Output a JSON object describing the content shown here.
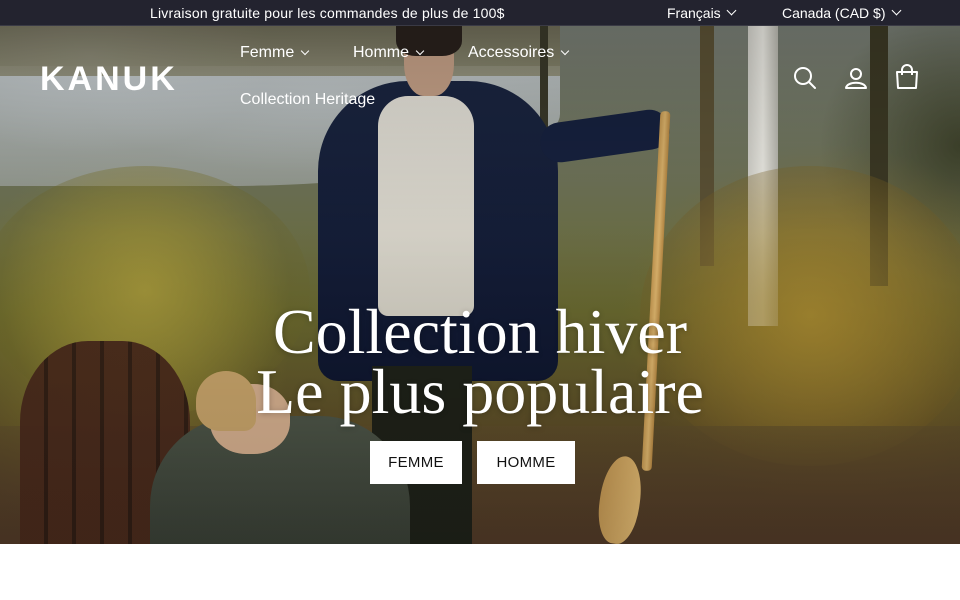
{
  "announcement": {
    "promo_text": "Livraison gratuite pour les commandes de plus de 100$",
    "language": "Français",
    "country": "Canada (CAD $)"
  },
  "header": {
    "logo": "KANUK",
    "nav": [
      {
        "label": "Femme",
        "has_dropdown": true
      },
      {
        "label": "Homme",
        "has_dropdown": true
      },
      {
        "label": "Accessoires",
        "has_dropdown": true
      },
      {
        "label": "Collection Heritage",
        "has_dropdown": false
      }
    ],
    "icons": [
      "search-icon",
      "account-icon",
      "cart-icon"
    ]
  },
  "hero": {
    "title_line1": "Collection hiver",
    "title_line2": "Le plus populaire",
    "buttons": [
      {
        "label": "FEMME"
      },
      {
        "label": "HOMME"
      }
    ]
  },
  "colors": {
    "announcement_bg": "#23232f",
    "text_on_hero": "#ffffff",
    "button_bg": "#ffffff",
    "button_text": "#111111"
  }
}
